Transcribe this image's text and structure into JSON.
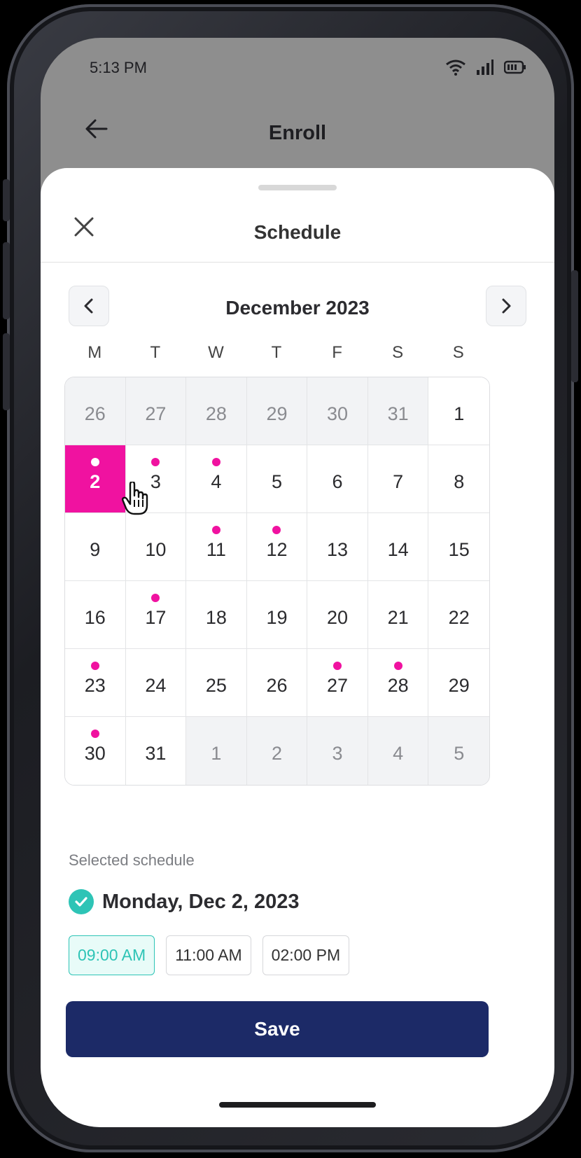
{
  "status_bar": {
    "time": "5:13 PM"
  },
  "app_bar": {
    "title": "Enroll"
  },
  "sheet": {
    "title": "Schedule"
  },
  "calendar": {
    "month_label": "December 2023",
    "weekdays": [
      "M",
      "T",
      "W",
      "T",
      "F",
      "S",
      "S"
    ],
    "days": [
      {
        "label": "26",
        "muted": true
      },
      {
        "label": "27",
        "muted": true
      },
      {
        "label": "28",
        "muted": true
      },
      {
        "label": "29",
        "muted": true
      },
      {
        "label": "30",
        "muted": true
      },
      {
        "label": "31",
        "muted": true
      },
      {
        "label": "1"
      },
      {
        "label": "2",
        "selected": true,
        "dot": true
      },
      {
        "label": "3",
        "dot": true
      },
      {
        "label": "4",
        "dot": true
      },
      {
        "label": "5"
      },
      {
        "label": "6"
      },
      {
        "label": "7"
      },
      {
        "label": "8"
      },
      {
        "label": "9"
      },
      {
        "label": "10"
      },
      {
        "label": "11",
        "dot": true
      },
      {
        "label": "12",
        "dot": true
      },
      {
        "label": "13"
      },
      {
        "label": "14"
      },
      {
        "label": "15"
      },
      {
        "label": "16"
      },
      {
        "label": "17",
        "dot": true
      },
      {
        "label": "18"
      },
      {
        "label": "19"
      },
      {
        "label": "20"
      },
      {
        "label": "21"
      },
      {
        "label": "22"
      },
      {
        "label": "23",
        "dot": true
      },
      {
        "label": "24"
      },
      {
        "label": "25"
      },
      {
        "label": "26"
      },
      {
        "label": "27",
        "dot": true
      },
      {
        "label": "28",
        "dot": true
      },
      {
        "label": "29"
      },
      {
        "label": "30",
        "dot": true
      },
      {
        "label": "31"
      },
      {
        "label": "1",
        "muted": true
      },
      {
        "label": "2",
        "muted": true
      },
      {
        "label": "3",
        "muted": true
      },
      {
        "label": "4",
        "muted": true
      },
      {
        "label": "5",
        "muted": true
      }
    ]
  },
  "selected": {
    "label": "Selected schedule",
    "date_text": "Monday, Dec 2, 2023",
    "times": [
      {
        "label": "09:00 AM",
        "active": true
      },
      {
        "label": "11:00 AM",
        "active": false
      },
      {
        "label": "02:00 PM",
        "active": false
      }
    ]
  },
  "save_label": "Save",
  "colors": {
    "accent_pink": "#f012a0",
    "accent_teal": "#2ec4b6",
    "primary_navy": "#1c2a67"
  },
  "icons": {
    "back": "arrow-left-icon",
    "close": "close-icon",
    "prev": "chevron-left-icon",
    "next": "chevron-right-icon",
    "cursor": "hand-pointer-icon",
    "check": "check-circle-icon"
  }
}
